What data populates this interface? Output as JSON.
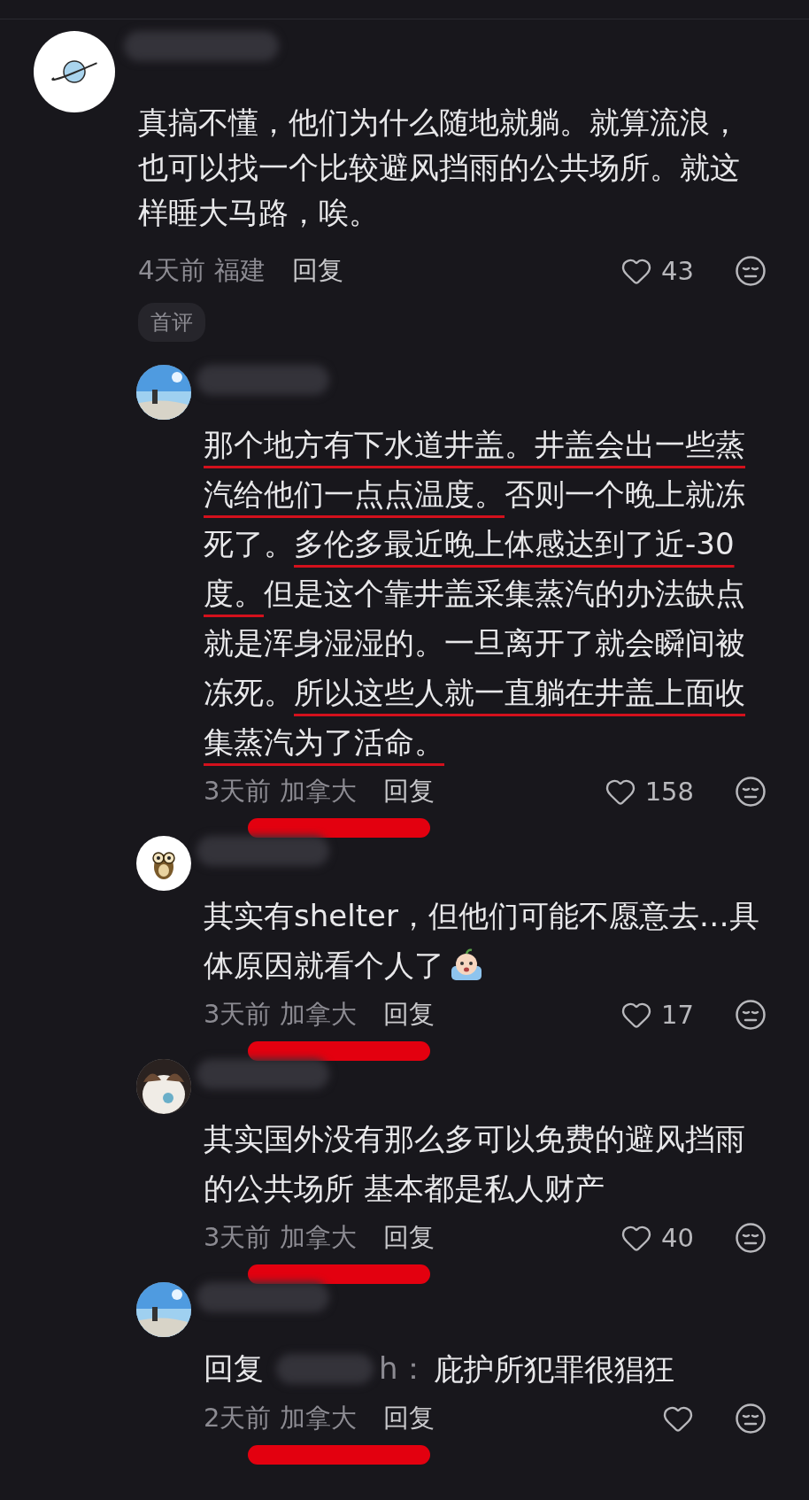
{
  "comments": [
    {
      "kind": "comment",
      "avatar": {
        "kind": "planet"
      },
      "lines": [
        [
          {
            "text": "真搞不懂，他们为什么随地就躺。就算流浪，",
            "underlined": false
          }
        ],
        [
          {
            "text": "也可以找一个比较避风挡雨的公共场所。就这",
            "underlined": false
          }
        ],
        [
          {
            "text": "样睡大马路，唉。",
            "underlined": false
          }
        ]
      ],
      "trailing_emoji": false,
      "time": "4天前",
      "location": "福建",
      "location_marked": false,
      "reply_label": "回复",
      "likes": "43",
      "tag": "首评"
    },
    {
      "kind": "reply",
      "avatar": {
        "kind": "picture"
      },
      "lines": [
        [
          {
            "text": "那个地方有下水道井盖。井盖会出一些蒸",
            "underlined": true
          }
        ],
        [
          {
            "text": "汽给他们一点点温度。",
            "underlined": true
          },
          {
            "text": "否则一个晚上就冻",
            "underlined": false
          }
        ],
        [
          {
            "text": "死了。",
            "underlined": false
          },
          {
            "text": "多伦多最近晚上体感达到了近-30",
            "underlined": true
          }
        ],
        [
          {
            "text": "度。",
            "underlined": true
          },
          {
            "text": "但是这个靠井盖采集蒸汽的办法缺点",
            "underlined": false
          }
        ],
        [
          {
            "text": "就是浑身湿湿的。一旦离开了就会瞬间被",
            "underlined": false
          }
        ],
        [
          {
            "text": "冻死。",
            "underlined": false
          },
          {
            "text": "所以这些人就一直躺在井盖上面收",
            "underlined": true
          }
        ],
        [
          {
            "text": "集蒸汽为了活命。",
            "underlined": true
          }
        ]
      ],
      "trailing_emoji": false,
      "time": "3天前",
      "location": "加拿大",
      "location_marked": true,
      "reply_label": "回复",
      "likes": "158"
    },
    {
      "kind": "reply",
      "avatar": {
        "kind": "owl"
      },
      "lines": [
        [
          {
            "text": "其实有shelter，但他们可能不愿意去…具",
            "underlined": false
          }
        ],
        [
          {
            "text": "体原因就看个人了",
            "underlined": false
          }
        ]
      ],
      "trailing_emoji": true,
      "time": "3天前",
      "location": "加拿大",
      "location_marked": true,
      "reply_label": "回复",
      "likes": "17"
    },
    {
      "kind": "reply",
      "avatar": {
        "kind": "picture"
      },
      "lines": [
        [
          {
            "text": "其实国外没有那么多可以免费的避风挡雨",
            "underlined": false
          }
        ],
        [
          {
            "text": "的公共场所 基本都是私人财产",
            "underlined": false
          }
        ]
      ],
      "trailing_emoji": false,
      "time": "3天前",
      "location": "加拿大",
      "location_marked": true,
      "reply_label": "回复",
      "likes": "40"
    },
    {
      "kind": "reply",
      "avatar": {
        "kind": "picture"
      },
      "reply_to": {
        "label": "回复",
        "name_tail": "h："
      },
      "lines": [
        [
          {
            "text": "庇护所犯罪很猖狂",
            "underlined": false
          }
        ]
      ],
      "trailing_emoji": false,
      "time": "2天前",
      "location": "加拿大",
      "location_marked": true,
      "reply_label": "回复"
    }
  ]
}
